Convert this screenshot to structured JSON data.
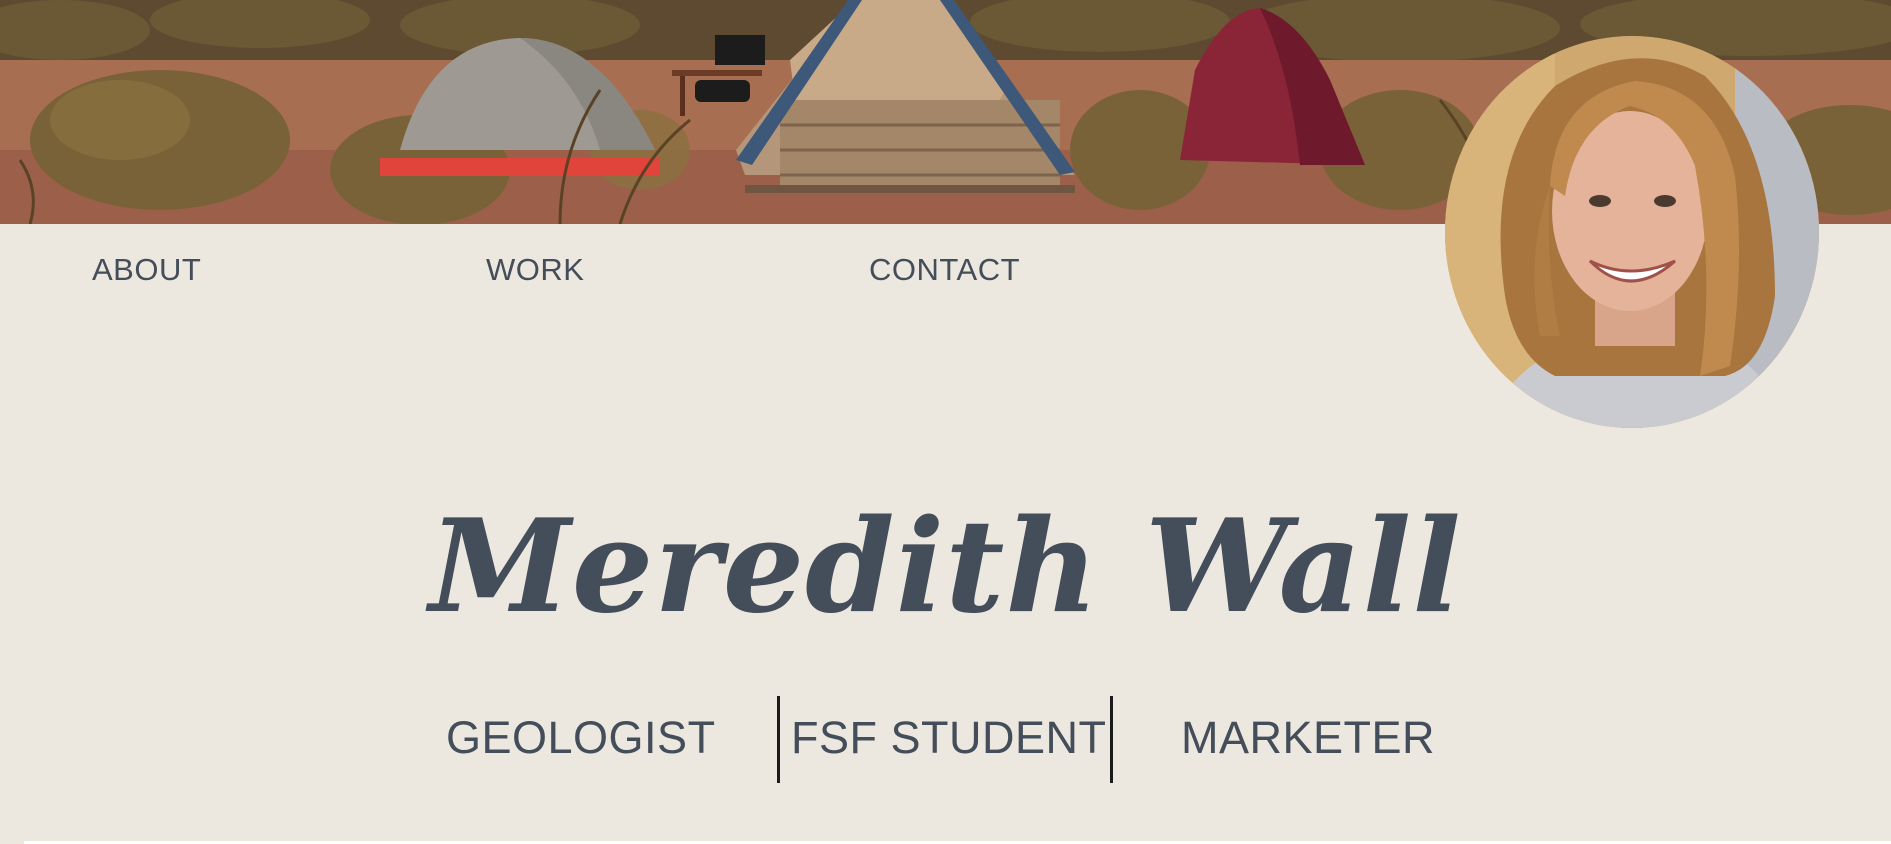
{
  "nav": {
    "about": "ABOUT",
    "work": "WORK",
    "contact": "CONTACT"
  },
  "hero": {
    "name": "Meredith Wall",
    "roles": [
      "GEOLOGIST",
      "FSF STUDENT",
      "MARKETER"
    ]
  },
  "colors": {
    "background": "#ece8df",
    "text": "#444d5a",
    "divider": "#1b1b1b"
  },
  "images": {
    "banner": "desert-campsite-photo",
    "avatar": "profile-photo"
  }
}
